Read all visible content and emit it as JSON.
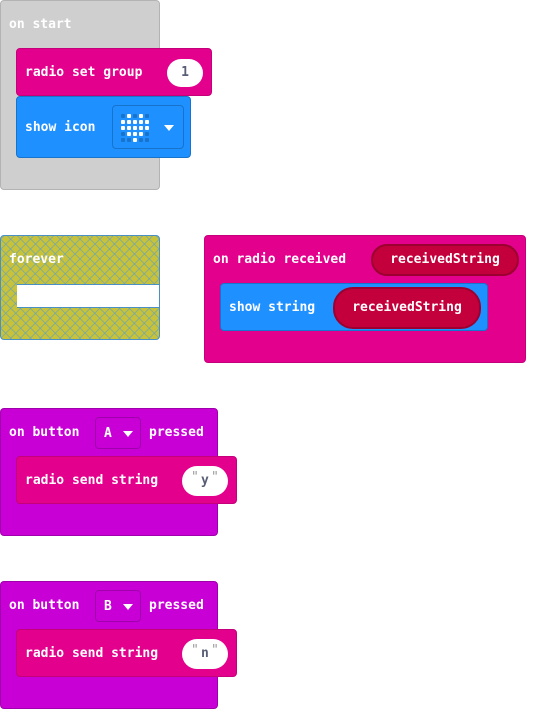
{
  "on_start": {
    "label": "on start",
    "radio_set_group": {
      "label": "radio set group",
      "value": "1"
    },
    "show_icon": {
      "label": "show icon",
      "icon": "heart"
    }
  },
  "forever": {
    "label": "forever"
  },
  "on_radio_received": {
    "label": "on radio received",
    "param": "receivedString",
    "show_string": {
      "label": "show string",
      "value": "receivedString"
    }
  },
  "button_a": {
    "label_prefix": "on button",
    "button": "A",
    "label_suffix": "pressed",
    "send": {
      "label": "radio send string",
      "quote_open": "\"",
      "value": "y",
      "quote_close": "\""
    }
  },
  "button_b": {
    "label_prefix": "on button",
    "button": "B",
    "label_suffix": "pressed",
    "send": {
      "label": "radio send string",
      "quote_open": "\"",
      "value": "n",
      "quote_close": "\""
    }
  },
  "colors": {
    "basic": "#1e90ff",
    "radio": "#e3008c",
    "input": "#c800d6",
    "variable": "#c4003c",
    "on_start": "#cfcfcf",
    "forever": "#c8c23a"
  }
}
